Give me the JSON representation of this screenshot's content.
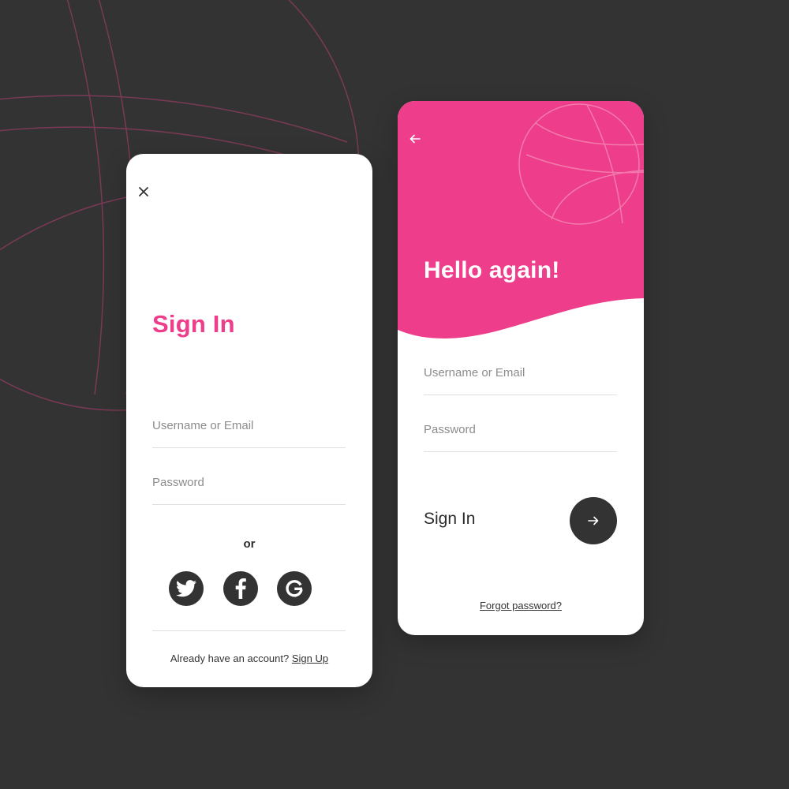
{
  "theme": {
    "background": "#333333",
    "accent": "#ee3d8a",
    "card": "#ffffff",
    "dark_button": "#333333"
  },
  "left_card": {
    "close_icon": "close-icon",
    "title": "Sign In",
    "username_placeholder": "Username or Email",
    "password_placeholder": "Password",
    "or_text": "or",
    "social": [
      {
        "name": "twitter",
        "icon": "twitter-icon"
      },
      {
        "name": "facebook",
        "icon": "facebook-icon"
      },
      {
        "name": "google",
        "icon": "google-icon"
      }
    ],
    "account_prompt": "Already have an account? ",
    "signup_link": "Sign Up"
  },
  "right_card": {
    "back_icon": "arrow-left-icon",
    "title": "Hello again!",
    "username_placeholder": "Username or Email",
    "password_placeholder": "Password",
    "signin_label": "Sign In",
    "submit_icon": "arrow-right-icon",
    "forgot_link": "Forgot password?"
  }
}
